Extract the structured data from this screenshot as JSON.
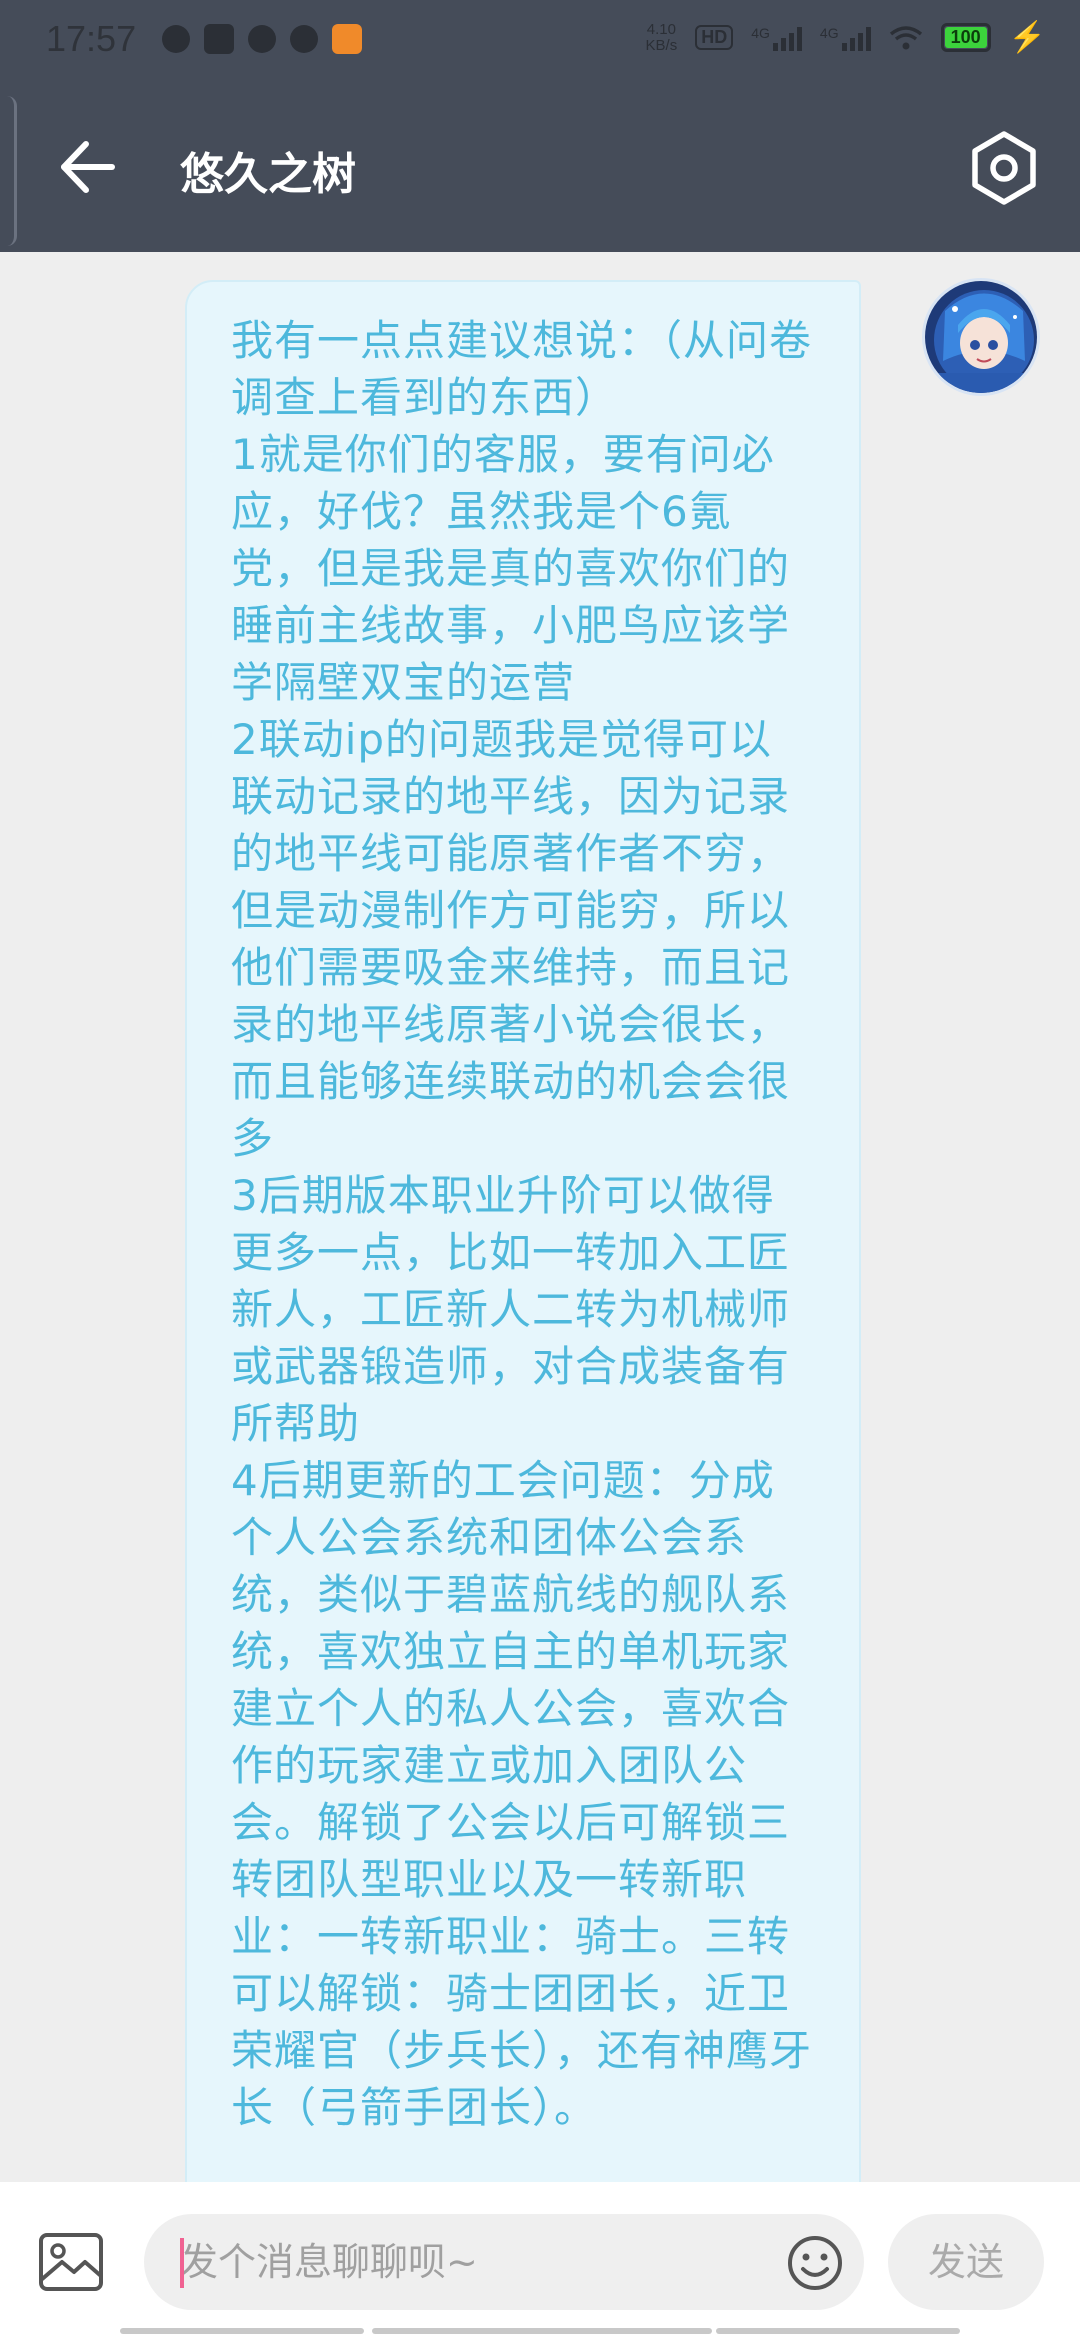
{
  "status_bar": {
    "time": "17:57",
    "net_speed_value": "4.10",
    "net_speed_unit": "KB/s",
    "hd_label": "HD",
    "sim1_label": "4G",
    "sim2_label": "4G",
    "battery_level": "100"
  },
  "header": {
    "title": "悠久之树",
    "back_icon": "arrow-left-icon",
    "settings_icon": "hexagon-settings-icon"
  },
  "chat": {
    "messages": [
      {
        "sender": "self",
        "text": "我有一点点建议想说：（从问卷调查上看到的东西）\n1就是你们的客服，要有问必应，好伐？虽然我是个6氪党，但是我是真的喜欢你们的睡前主线故事，小肥鸟应该学学隔壁双宝的运营\n2联动ip的问题我是觉得可以联动记录的地平线，因为记录的地平线可能原著作者不穷，但是动漫制作方可能穷，所以他们需要吸金来维持，而且记录的地平线原著小说会很长，而且能够连续联动的机会会很多\n3后期版本职业升阶可以做得更多一点，比如一转加入工匠新人，工匠新人二转为机械师或武器锻造师，对合成装备有所帮助\n4后期更新的工会问题：分成个人公会系统和团体公会系统，类似于碧蓝航线的舰队系统，喜欢独立自主的单机玩家建立个人的私人公会，喜欢合作的玩家建立或加入团队公会。解锁了公会以后可解锁三转团队型职业以及一转新职业：一转新职业：骑士。三转可以解锁：骑士团团长，近卫荣耀官（步兵长），还有神鹰牙长（弓箭手团长）。"
      }
    ]
  },
  "input_bar": {
    "placeholder": "发个消息聊聊呗~",
    "send_label": "发送",
    "gallery_icon": "image-icon",
    "emoji_icon": "smiley-icon"
  },
  "colors": {
    "header_bg": "#454c59",
    "bubble_bg": "#e6f6fc",
    "bubble_text": "#4db8dc",
    "page_bg": "#eeeeee"
  }
}
